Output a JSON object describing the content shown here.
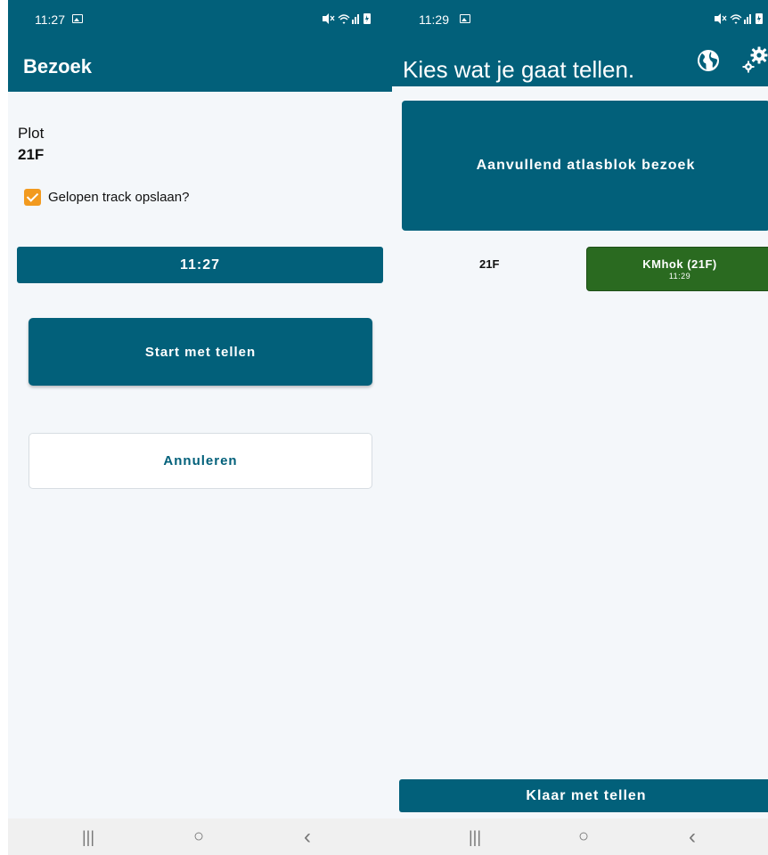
{
  "colors": {
    "primary": "#02607a",
    "accent_checkbox": "#f29a1f",
    "success_button": "#2a6a20",
    "background": "#f4f7fa"
  },
  "left_screen": {
    "status_bar": {
      "time": "11:27",
      "system_icons": "~! ≈.│ ▮"
    },
    "app_bar": {
      "title": "Bezoek"
    },
    "plot": {
      "label": "Plot",
      "value": "21F"
    },
    "track_checkbox": {
      "label": "Gelopen track opslaan?",
      "checked": true
    },
    "time_button": {
      "label": "11:27"
    },
    "start_button": {
      "label": "Start met tellen"
    },
    "cancel_button": {
      "label": "Annuleren"
    },
    "nav_bar": {
      "recent": "|||",
      "home": "○",
      "back": "‹"
    }
  },
  "right_screen": {
    "status_bar": {
      "time": "11:29",
      "system_icons": "~! ≈.│ ▮"
    },
    "app_bar": {
      "title": "Kies wat je gaat tellen.",
      "icons": [
        "globe-icon",
        "settings-gear-icon"
      ]
    },
    "aanvullend_button": {
      "label": "Aanvullend atlasblok bezoek"
    },
    "plot_code": "21F",
    "kmhok_button": {
      "label": "KMhok (21F)",
      "time": "11:29"
    },
    "klaar_button": {
      "label": "Klaar met tellen"
    },
    "nav_bar": {
      "recent": "|||",
      "home": "○",
      "back": "‹"
    }
  }
}
